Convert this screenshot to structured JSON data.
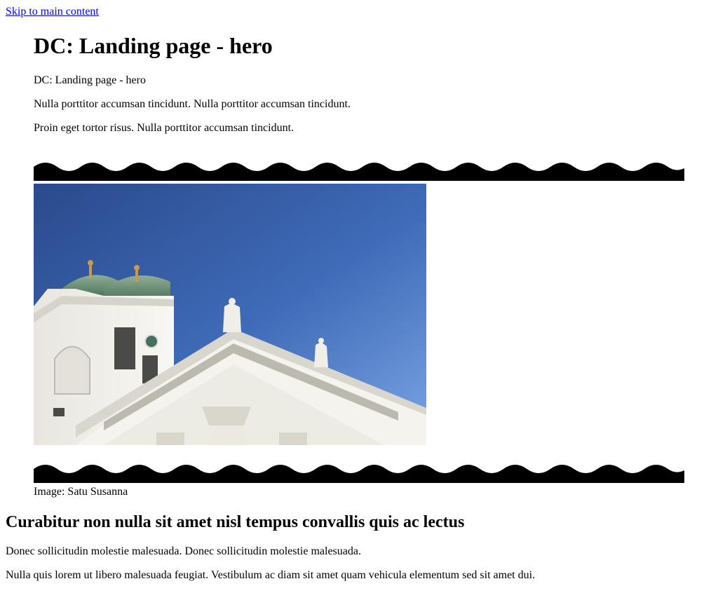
{
  "skip_link": {
    "label": "Skip to main content"
  },
  "hero": {
    "title": "DC: Landing page - hero",
    "subtitle": "DC: Landing page - hero",
    "paragraph_1": "Nulla porttitor accumsan tincidunt. Nulla porttitor accumsan tincidunt.",
    "paragraph_2": "Proin eget tortor risus. Nulla porttitor accumsan tincidunt.",
    "image_alt": "Helsinki Cathedral",
    "image_credit": "Image: Satu Susanna"
  },
  "section": {
    "heading": "Curabitur non nulla sit amet nisl tempus convallis quis ac lectus",
    "paragraph_1": "Donec sollicitudin molestie malesuada. Donec sollicitudin molestie malesuada.",
    "paragraph_2": "Nulla quis lorem ut libero malesuada feugiat. Vestibulum ac diam sit amet quam vehicula elementum sed sit amet dui."
  },
  "colors": {
    "link": "#0000ee",
    "wave": "#000000",
    "sky_top": "#2d5092",
    "sky_bottom": "#6d9be0",
    "building": "#f2f1ec",
    "dome": "#6d8f74"
  }
}
